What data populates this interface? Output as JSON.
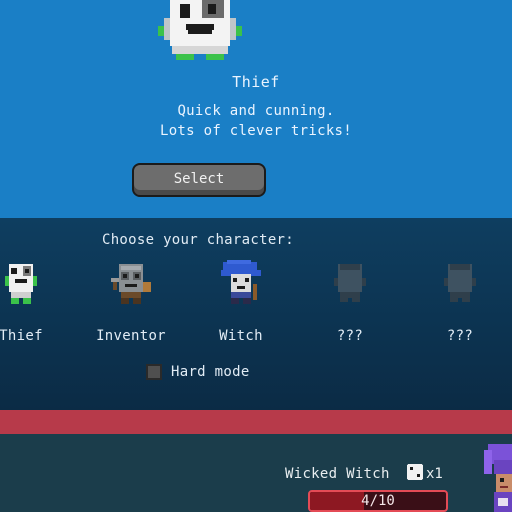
{
  "selected": {
    "name": "Thief",
    "description_lines": [
      "Quick and cunning.",
      "Lots of clever tricks!"
    ],
    "select_label": "Select"
  },
  "chooser": {
    "heading": "Choose your character:",
    "characters": [
      {
        "label": "Thief",
        "locked": false
      },
      {
        "label": "Inventor",
        "locked": false
      },
      {
        "label": "Witch",
        "locked": false
      },
      {
        "label": "???",
        "locked": true
      },
      {
        "label": "???",
        "locked": true
      }
    ],
    "hard_mode_label": "Hard mode",
    "hard_mode_checked": false
  },
  "enemy": {
    "name": "Wicked Witch",
    "dice_icon": "die-icon",
    "dice_count": "x1",
    "hp_text": "4/10",
    "hp_fraction": 0.4
  },
  "colors": {
    "top_panel": "#1a7fc6",
    "bottom_panel": "#0e3e60",
    "band": "#b73a4a",
    "battle_bg": "#1b3d4b",
    "hp_border": "#e44b56"
  }
}
